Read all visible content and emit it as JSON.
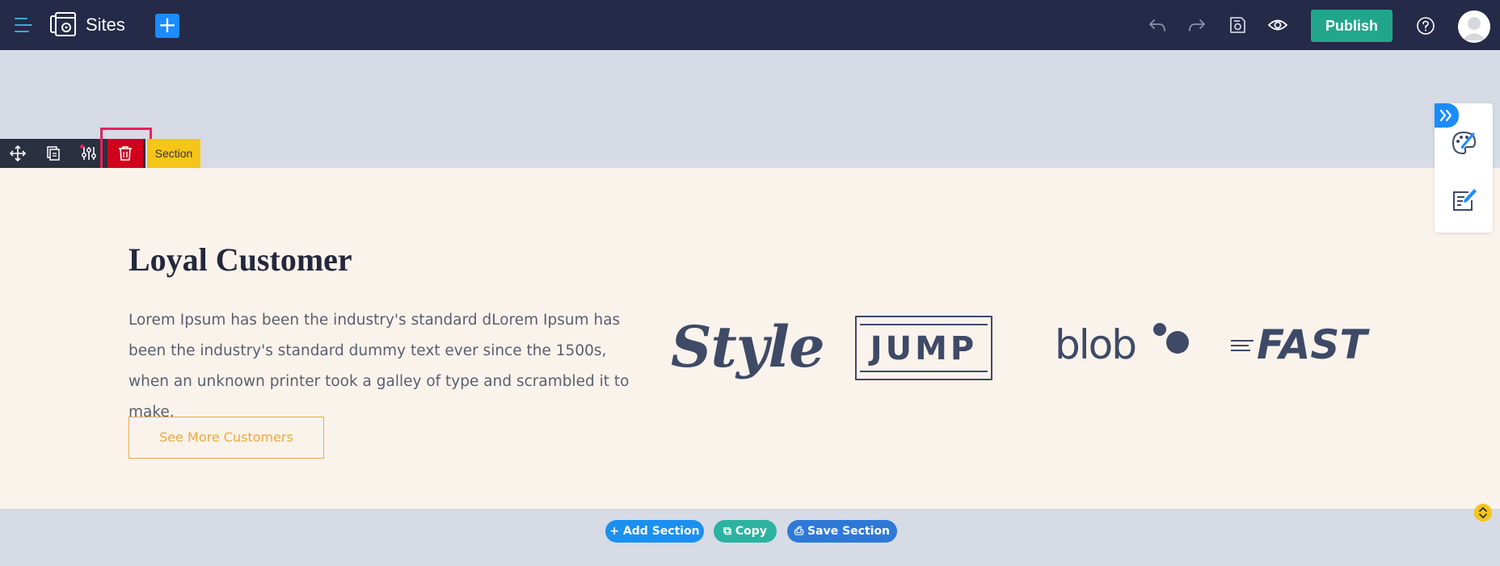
{
  "header": {
    "app_title": "Sites",
    "publish_label": "Publish",
    "icons": [
      "menu-icon",
      "sites-logo-icon",
      "plus-icon",
      "undo-icon",
      "redo-icon",
      "save-icon",
      "preview-eye-icon",
      "help-icon",
      "avatar"
    ]
  },
  "section_toolbar": {
    "label": "Section",
    "tools": [
      "move-icon",
      "duplicate-icon",
      "settings-sliders-icon",
      "trash-icon"
    ]
  },
  "content": {
    "heading": "Loyal Customer",
    "body": "Lorem Ipsum has been the industry's standard dLorem Ipsum has been the industry's standard dummy text ever since the 1500s, when an unknown printer took a galley of type and scrambled it to make.",
    "cta_label": "See More Customers",
    "logos": {
      "style": "Style",
      "jump": "JUMP",
      "blob": "blob",
      "fast": "FAST"
    }
  },
  "bottom_actions": {
    "add_section": "+ Add Section",
    "copy": "Copy",
    "save_section": "Save Section"
  },
  "side_panel": {
    "icons": [
      "collapse-chevron-icon",
      "palette-brush-icon",
      "edit-document-icon"
    ]
  },
  "colors": {
    "topbar": "#252a48",
    "canvas": "#d7dbe6",
    "section_bg": "#faf3ec",
    "publish": "#22a68b",
    "delete": "#d0021b",
    "highlight": "#e8215e",
    "section_label": "#f5c518",
    "accent_blue": "#1a8cff",
    "cta_orange": "#f0a83a"
  }
}
